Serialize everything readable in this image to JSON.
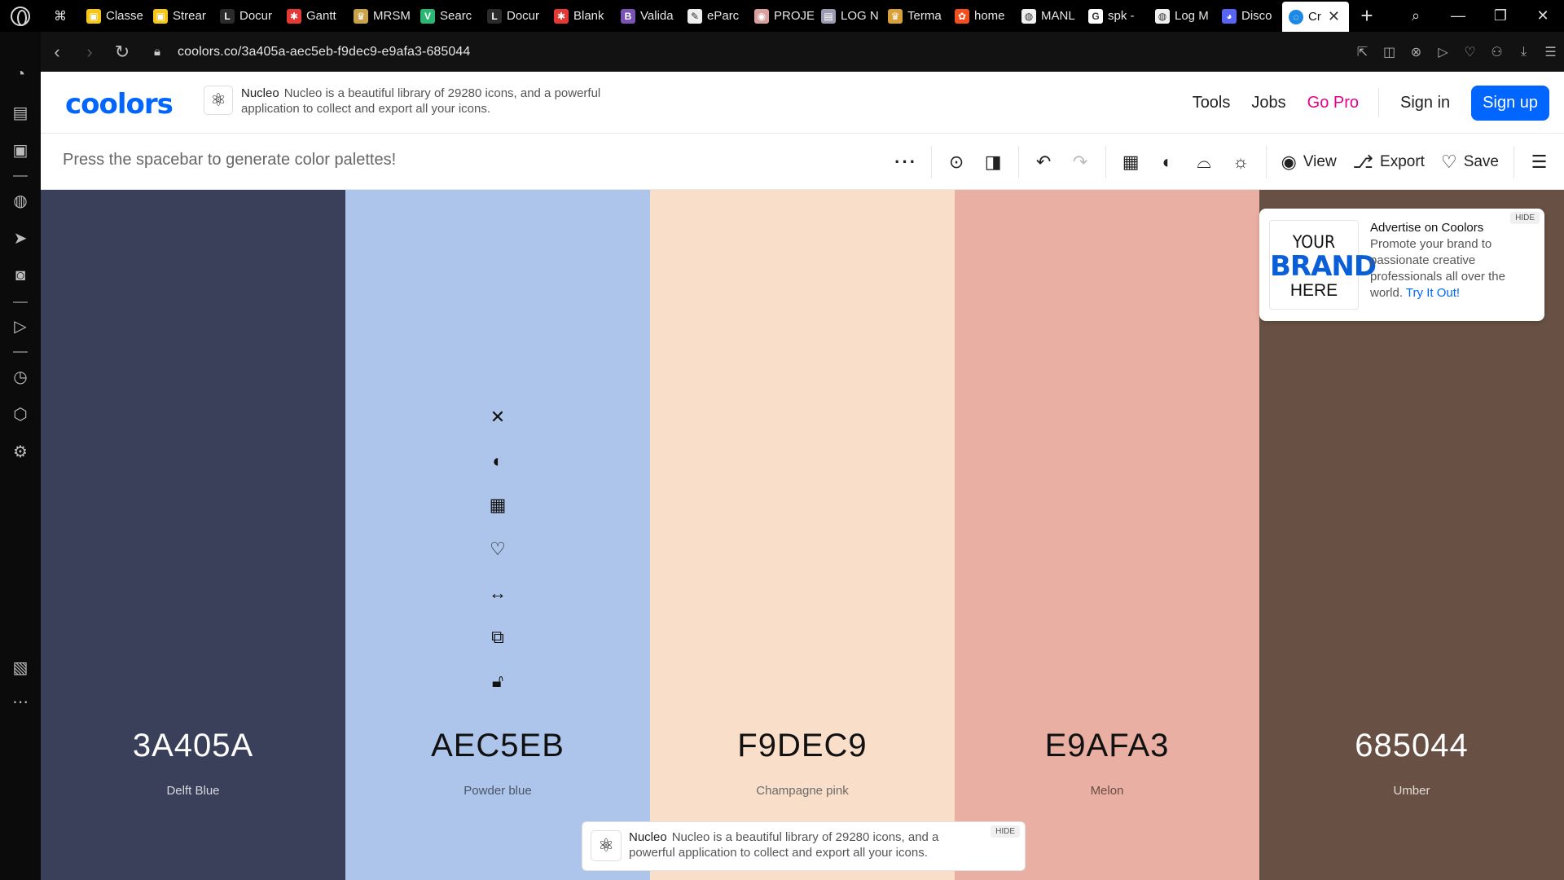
{
  "browser": {
    "tabs": [
      {
        "title": "Classe",
        "color": "#f5c518",
        "glyph": "▣"
      },
      {
        "title": "Strear",
        "color": "#f5c518",
        "glyph": "▣"
      },
      {
        "title": "Docur",
        "color": "#2b2b2b",
        "glyph": "L"
      },
      {
        "title": "Gantt",
        "color": "#e53935",
        "glyph": "✱"
      },
      {
        "title": "MRSM",
        "color": "#caa24a",
        "glyph": "♛"
      },
      {
        "title": "Searc",
        "color": "#2bb673",
        "glyph": "V"
      },
      {
        "title": "Docur",
        "color": "#2b2b2b",
        "glyph": "L"
      },
      {
        "title": "Blank",
        "color": "#e53935",
        "glyph": "✱"
      },
      {
        "title": "Valida",
        "color": "#7952b3",
        "glyph": "B"
      },
      {
        "title": "eParc",
        "color": "#eeeeee",
        "glyph": "✎"
      },
      {
        "title": "PROJE",
        "color": "#d9a0a0",
        "glyph": "◉"
      },
      {
        "title": "LOG N",
        "color": "#9a9ab0",
        "glyph": "▤"
      },
      {
        "title": "Terma",
        "color": "#d8a038",
        "glyph": "♛"
      },
      {
        "title": "home",
        "color": "#f24e1e",
        "glyph": "✿"
      },
      {
        "title": "MANL",
        "color": "#f0f0f0",
        "glyph": "◍"
      },
      {
        "title": "spk -",
        "color": "#ffffff",
        "glyph": "G"
      },
      {
        "title": "Log M",
        "color": "#f0f0f0",
        "glyph": "◍"
      },
      {
        "title": "Disco",
        "color": "#5865f2",
        "glyph": "◕"
      }
    ],
    "active_tab": {
      "title": "Cr",
      "close": "✕"
    },
    "new_tab": "+",
    "url": "coolors.co/3a405a-aec5eb-f9dec9-e9afa3-685044"
  },
  "site": {
    "logo": "coolors",
    "top_ad": {
      "name": "Nucleo",
      "text": "Nucleo is a beautiful library of 29280 icons, and a powerful application to collect and export all your icons."
    },
    "nav": {
      "tools": "Tools",
      "jobs": "Jobs",
      "go_pro": "Go Pro",
      "sign_in": "Sign in",
      "sign_up": "Sign up"
    },
    "toolbar": {
      "hint": "Press the spacebar to generate color palettes!",
      "view": "View",
      "export": "Export",
      "save": "Save"
    }
  },
  "palette": [
    {
      "hex": "3A405A",
      "name": "Delft Blue",
      "color": "#3a405a",
      "text_color": "#ffffff",
      "name_color": "#d7d9e0"
    },
    {
      "hex": "AEC5EB",
      "name": "Powder blue",
      "color": "#aec5eb",
      "text_color": "#111111",
      "name_color": "#4a5568"
    },
    {
      "hex": "F9DEC9",
      "name": "Champagne pink",
      "color": "#f9dec9",
      "text_color": "#111111",
      "name_color": "#6b6b6b"
    },
    {
      "hex": "E9AFA3",
      "name": "Melon",
      "color": "#e9afa3",
      "text_color": "#111111",
      "name_color": "#6b4b45"
    },
    {
      "hex": "685044",
      "name": "Umber",
      "color": "#685044",
      "text_color": "#ffffff",
      "name_color": "#e6dcd6"
    }
  ],
  "right_ad": {
    "brand_line1": "YOUR",
    "brand_line2": "BRAND",
    "brand_line3": "HERE",
    "heading": "Advertise on Coolors",
    "body": "Promote your brand to passionate creative professionals all over the world.",
    "link": "Try It Out!",
    "hide": "HIDE"
  },
  "bottom_ad": {
    "name": "Nucleo",
    "text": "Nucleo is a beautiful library of 29280 icons, and a powerful application to collect and export all your icons.",
    "hide": "HIDE"
  }
}
